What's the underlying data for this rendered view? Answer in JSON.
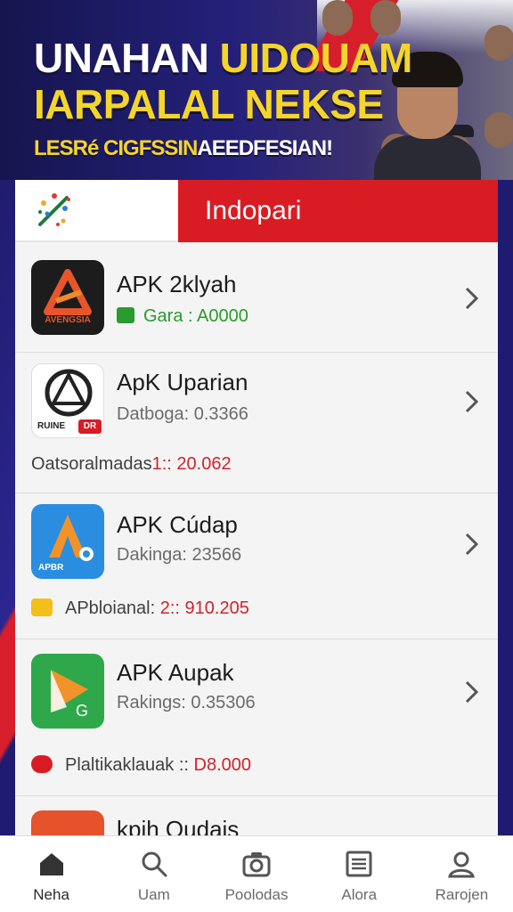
{
  "hero": {
    "title_line1_a": "UNAHAN",
    "title_line1_b": "UIDOUAM",
    "title_line2": "IARPALAL NEKSE",
    "subtitle_a": "LESRé CIGFSSIN",
    "subtitle_b": "AEEDFESIAN!"
  },
  "header": {
    "title": "Indopari"
  },
  "apps": [
    {
      "name": "APK 2klyah",
      "meta": "Gara : A0000",
      "icon_text": "AVENGSIA",
      "icon": "triangle-a-icon",
      "accent": "#e8552b"
    },
    {
      "name": "ApK Uparian",
      "meta": "Datboga: 0.3366",
      "icon_text": "RUINE",
      "icon_badge": "DR",
      "icon": "emblem-icon",
      "extra_label": "Oatsoralmadas",
      "extra_value": "1:: 20.062"
    },
    {
      "name": "APK Cúdap",
      "meta": "Dakinga: 23566",
      "icon_text": "APBR",
      "icon": "blue-a-icon",
      "extra_label": "APbloianal:",
      "extra_value": "2:: 910.205"
    },
    {
      "name": "APK Aupak",
      "meta": "Rakings: 0.35306",
      "icon": "green-play-icon",
      "extra_label": "Plaltikaklauak ::",
      "extra_value": "D8.000"
    },
    {
      "name": "kpih Qudais",
      "icon": "red-app-icon"
    }
  ],
  "nav": {
    "items": [
      {
        "label": "Neha",
        "icon": "home-icon"
      },
      {
        "label": "Uam",
        "icon": "search-icon"
      },
      {
        "label": "Poolodas",
        "icon": "camera-icon"
      },
      {
        "label": "Alora",
        "icon": "list-icon"
      },
      {
        "label": "Rarojen",
        "icon": "profile-icon"
      }
    ]
  },
  "colors": {
    "accent_red": "#d91c24",
    "hero_blue": "#24207a",
    "hero_yellow": "#f4d52b",
    "meta_green": "#2a9b2e",
    "value_red": "#d0232b"
  }
}
